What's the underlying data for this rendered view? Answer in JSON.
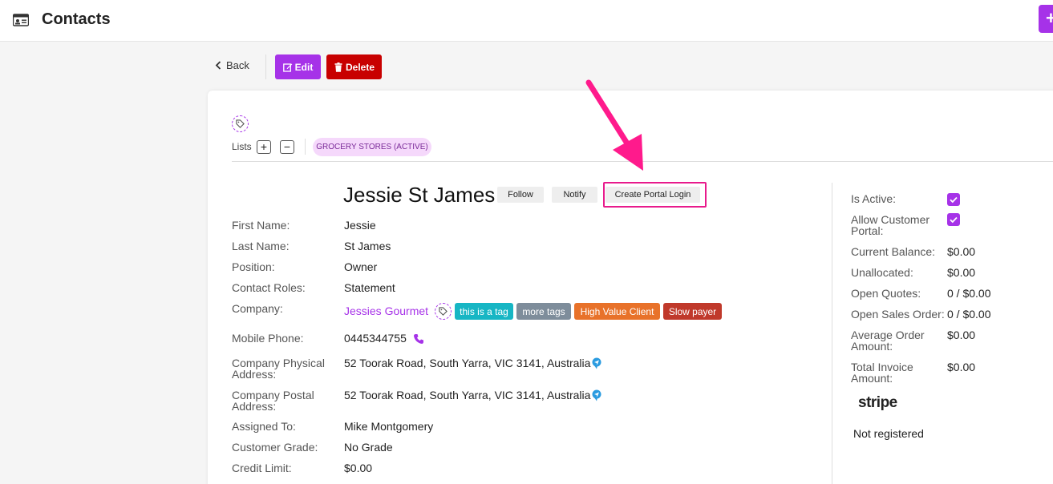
{
  "app": {
    "title": "Contacts",
    "add_label": "+"
  },
  "toolbar": {
    "back_label": "Back",
    "edit_label": "Edit",
    "delete_label": "Delete"
  },
  "lists": {
    "label": "Lists",
    "add": "+",
    "remove": "−",
    "badge": "GROCERY STORES (ACTIVE)"
  },
  "contact": {
    "name": "Jessie St James",
    "actions": {
      "follow": "Follow",
      "notify": "Notify",
      "create_portal": "Create Portal Login"
    },
    "fields": {
      "first_name": {
        "label": "First Name:",
        "value": "Jessie"
      },
      "last_name": {
        "label": "Last Name:",
        "value": "St James"
      },
      "position": {
        "label": "Position:",
        "value": "Owner"
      },
      "contact_roles": {
        "label": "Contact Roles:",
        "value": "Statement"
      },
      "company": {
        "label": "Company:",
        "value": "Jessies Gourmet"
      },
      "mobile_phone": {
        "label": "Mobile Phone:",
        "value": "0445344755"
      },
      "physical_address": {
        "label_1": "Company Physical",
        "label_2": "Address:",
        "value": "52 Toorak Road, South Yarra, VIC 3141, Australia"
      },
      "postal_address": {
        "label_1": "Company Postal",
        "label_2": "Address:",
        "value": "52 Toorak Road, South Yarra, VIC 3141, Australia"
      },
      "assigned_to": {
        "label": "Assigned To:",
        "value": "Mike Montgomery"
      },
      "customer_grade": {
        "label": "Customer Grade:",
        "value": "No Grade"
      },
      "credit_limit": {
        "label": "Credit Limit:",
        "value": "$0.00"
      }
    },
    "tags": [
      {
        "label": "this is a tag",
        "color": "#17b6c4"
      },
      {
        "label": "more tags",
        "color": "#7e8d9b"
      },
      {
        "label": "High Value Client",
        "color": "#e8722a"
      },
      {
        "label": "Slow payer",
        "color": "#c0392b"
      }
    ]
  },
  "summary": {
    "is_active": {
      "label": "Is Active:",
      "checked": true
    },
    "allow_portal": {
      "label_1": "Allow Customer",
      "label_2": "Portal:",
      "checked": true
    },
    "current_balance": {
      "label": "Current Balance:",
      "value": "$0.00"
    },
    "unallocated": {
      "label": "Unallocated:",
      "value": "$0.00"
    },
    "open_quotes": {
      "label": "Open Quotes:",
      "value": "0 / $0.00"
    },
    "open_sales_order": {
      "label": "Open Sales Order:",
      "value": "0 / $0.00"
    },
    "avg_order": {
      "label_1": "Average Order",
      "label_2": "Amount:",
      "value": "$0.00"
    },
    "total_invoice": {
      "label_1": "Total Invoice",
      "label_2": "Amount:",
      "value": "$0.00"
    },
    "stripe": {
      "logo": "stripe",
      "status": "Not registered"
    }
  },
  "colors": {
    "accent": "#a632e8",
    "danger": "#c80000",
    "highlight": "#e81a8c",
    "map_pin": "#2a9be0"
  }
}
